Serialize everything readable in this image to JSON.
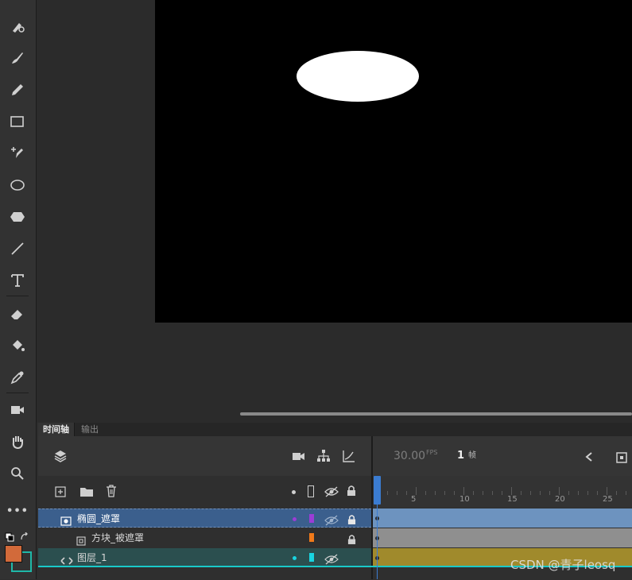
{
  "toolbar": {
    "tools": [
      "brush-paint-icon",
      "brush-icon",
      "pencil-icon",
      "rectangle-icon",
      "pen-add-icon",
      "oval-icon",
      "polystar-icon",
      "line-icon",
      "text-icon",
      "eraser-icon",
      "paint-bucket-icon",
      "eyedropper-icon",
      "camera-icon",
      "hand-icon",
      "zoom-icon",
      "more-icon"
    ],
    "more_label": "•••",
    "stroke_color": "#1fb8a8",
    "fill_color": "#d26a3a"
  },
  "stage": {
    "background": "#000000",
    "shape": "white-ellipse"
  },
  "timeline": {
    "tabs": [
      "时间轴",
      "输出"
    ],
    "fps_value": "30.00",
    "fps_unit": "FPS",
    "current_frame": "1",
    "frame_label": "帧",
    "ruler_numbers": [
      "5",
      "10",
      "15",
      "20",
      "25"
    ],
    "layers": [
      {
        "name": "椭圆_遮罩",
        "type": "mask",
        "color": "#9b3dd6",
        "selected": true,
        "track_color": "#6d93bf"
      },
      {
        "name": "方块_被遮罩",
        "type": "masked",
        "color": "#f07a1a",
        "selected": false,
        "track_color": "#8f8f8f"
      },
      {
        "name": "图层_1",
        "type": "normal",
        "color": "#19d4e0",
        "selected": false,
        "track_color": "#a08a2c"
      }
    ]
  },
  "watermark": "CSDN @青子leosq"
}
